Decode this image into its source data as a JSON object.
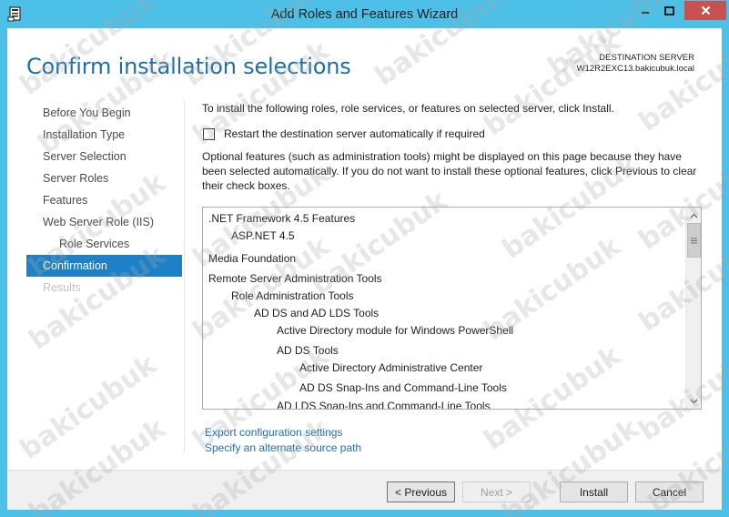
{
  "window": {
    "title": "Add Roles and Features Wizard",
    "min_glyph": "—",
    "max_glyph": "☐",
    "close_glyph": "✕"
  },
  "page": {
    "title": "Confirm installation selections",
    "destination_label": "DESTINATION SERVER",
    "destination_server": "W12R2EXC13.bakicubuk.local"
  },
  "nav": {
    "items": [
      {
        "label": "Before You Begin",
        "state": "normal"
      },
      {
        "label": "Installation Type",
        "state": "normal"
      },
      {
        "label": "Server Selection",
        "state": "normal"
      },
      {
        "label": "Server Roles",
        "state": "normal"
      },
      {
        "label": "Features",
        "state": "normal"
      },
      {
        "label": "Web Server Role (IIS)",
        "state": "normal"
      },
      {
        "label": "Role Services",
        "state": "sub"
      },
      {
        "label": "Confirmation",
        "state": "active"
      },
      {
        "label": "Results",
        "state": "disabled"
      }
    ]
  },
  "content": {
    "intro": "To install the following roles, role services, or features on selected server, click Install.",
    "restart_label": "Restart the destination server automatically if required",
    "restart_checked": false,
    "optional_text": "Optional features (such as administration tools) might be displayed on this page because they have been selected automatically. If you do not want to install these optional features, click Previous to clear their check boxes."
  },
  "selections": [
    {
      "label": ".NET Framework 4.5 Features",
      "level": 0
    },
    {
      "label": "ASP.NET 4.5",
      "level": 1
    },
    {
      "label": "Media Foundation",
      "level": 0
    },
    {
      "label": "Remote Server Administration Tools",
      "level": 0
    },
    {
      "label": "Role Administration Tools",
      "level": 1
    },
    {
      "label": "AD DS and AD LDS Tools",
      "level": 2
    },
    {
      "label": "Active Directory module for Windows PowerShell",
      "level": 3
    },
    {
      "label": "AD DS Tools",
      "level": 3
    },
    {
      "label": "Active Directory Administrative Center",
      "level": 4
    },
    {
      "label": "AD DS Snap-Ins and Command-Line Tools",
      "level": 4
    },
    {
      "label": "AD LDS Snap-Ins and Command-Line Tools",
      "level": 3
    }
  ],
  "links": {
    "export": "Export configuration settings",
    "alternate": "Specify an alternate source path"
  },
  "buttons": {
    "previous": "< Previous",
    "next": "Next >",
    "install": "Install",
    "cancel": "Cancel"
  },
  "watermark": "bakicubuk"
}
